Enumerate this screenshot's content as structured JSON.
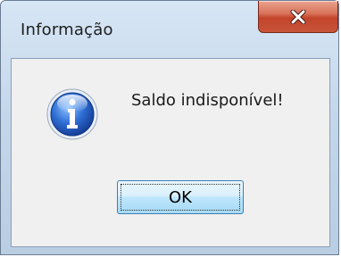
{
  "dialog": {
    "title": "Informação",
    "message": "Saldo indisponível!",
    "ok_label": "OK",
    "icon": "information-icon",
    "close_icon": "close-icon"
  },
  "colors": {
    "title_bar": "#c4d7ea",
    "client_background": "#f0f0f0",
    "close_button": "#c8553a",
    "ok_button": "#bee6fd"
  }
}
